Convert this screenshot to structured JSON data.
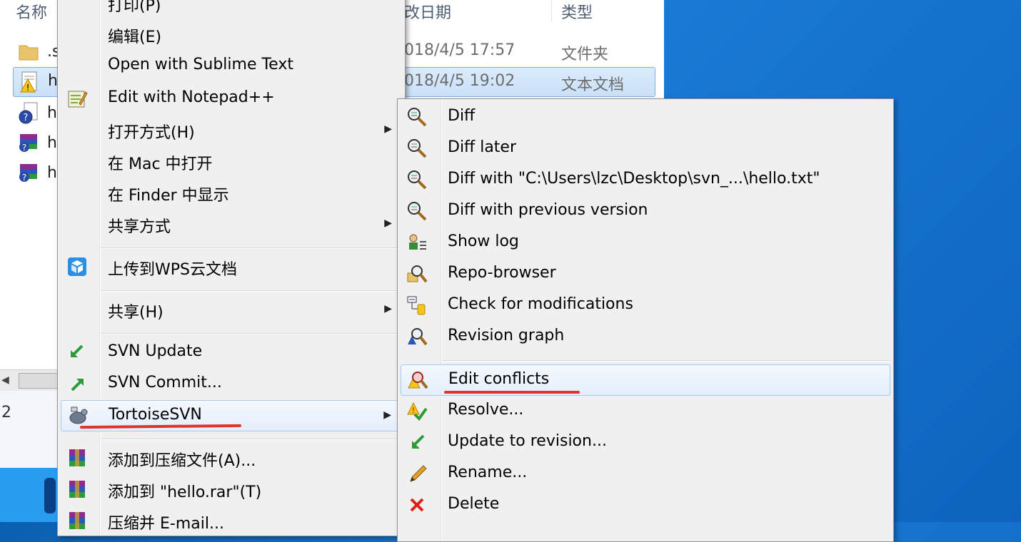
{
  "explorer": {
    "columns": {
      "name": "名称",
      "date": "改日期",
      "type": "类型"
    },
    "rows": [
      {
        "name": ".s",
        "date": "018/4/5 17:57",
        "type": "文件夹",
        "icon": "folder-icon"
      },
      {
        "name": "h",
        "date": "018/4/5 19:02",
        "type": "文本文档",
        "icon": "conflict-text-file-icon",
        "selected": true
      },
      {
        "name": "h",
        "date": "",
        "type": "",
        "icon": "unversioned-file-icon"
      },
      {
        "name": "h",
        "date": "",
        "type": "",
        "icon": "rar-archive-icon"
      },
      {
        "name": "h",
        "date": "",
        "type": "",
        "icon": "rar-archive-icon"
      }
    ],
    "status_count": "2"
  },
  "main_menu": {
    "items": [
      {
        "label": "打印(P)"
      },
      {
        "label": "编辑(E)"
      },
      {
        "label": "Open with Sublime Text"
      },
      {
        "label": "Edit with Notepad++",
        "icon": "notepad-plus-icon"
      },
      {
        "label": "打开方式(H)",
        "submenu": true
      },
      {
        "label": "在 Mac 中打开"
      },
      {
        "label": "在 Finder 中显示"
      },
      {
        "label": "共享方式",
        "submenu": true
      },
      {
        "label": "上传到WPS云文档",
        "icon": "wps-cloud-icon"
      },
      {
        "label": "共享(H)",
        "submenu": true
      },
      {
        "label": "SVN Update",
        "icon": "svn-update-icon"
      },
      {
        "label": "SVN Commit...",
        "icon": "svn-commit-icon"
      },
      {
        "label": "TortoiseSVN",
        "icon": "tortoisesvn-icon",
        "submenu": true,
        "highlighted": true
      },
      {
        "label": "添加到压缩文件(A)...",
        "icon": "winrar-icon"
      },
      {
        "label": "添加到 \"hello.rar\"(T)",
        "icon": "winrar-icon"
      },
      {
        "label": "压缩并 E-mail...",
        "icon": "winrar-icon"
      }
    ]
  },
  "sub_menu": {
    "items": [
      {
        "label": "Diff",
        "icon": "diff-icon"
      },
      {
        "label": "Diff later",
        "icon": "diff-icon"
      },
      {
        "label": "Diff with \"C:\\Users\\lzc\\Desktop\\svn_...\\hello.txt\"",
        "icon": "diff-icon"
      },
      {
        "label": "Diff with previous version",
        "icon": "diff-icon"
      },
      {
        "label": "Show log",
        "icon": "show-log-icon"
      },
      {
        "label": "Repo-browser",
        "icon": "repo-browser-icon"
      },
      {
        "label": "Check for modifications",
        "icon": "check-modifications-icon"
      },
      {
        "label": "Revision graph",
        "icon": "revision-graph-icon"
      },
      {
        "label": "Edit conflicts",
        "icon": "edit-conflicts-icon",
        "highlighted": true
      },
      {
        "label": "Resolve...",
        "icon": "resolve-icon"
      },
      {
        "label": "Update to revision...",
        "icon": "update-revision-icon"
      },
      {
        "label": "Rename...",
        "icon": "rename-icon"
      },
      {
        "label": "Delete",
        "icon": "delete-icon"
      }
    ]
  },
  "colors": {
    "annotation_red": "#e0332a",
    "menu_bg": "#f0f0f0",
    "desktop_blue": "#1a7bd6"
  }
}
